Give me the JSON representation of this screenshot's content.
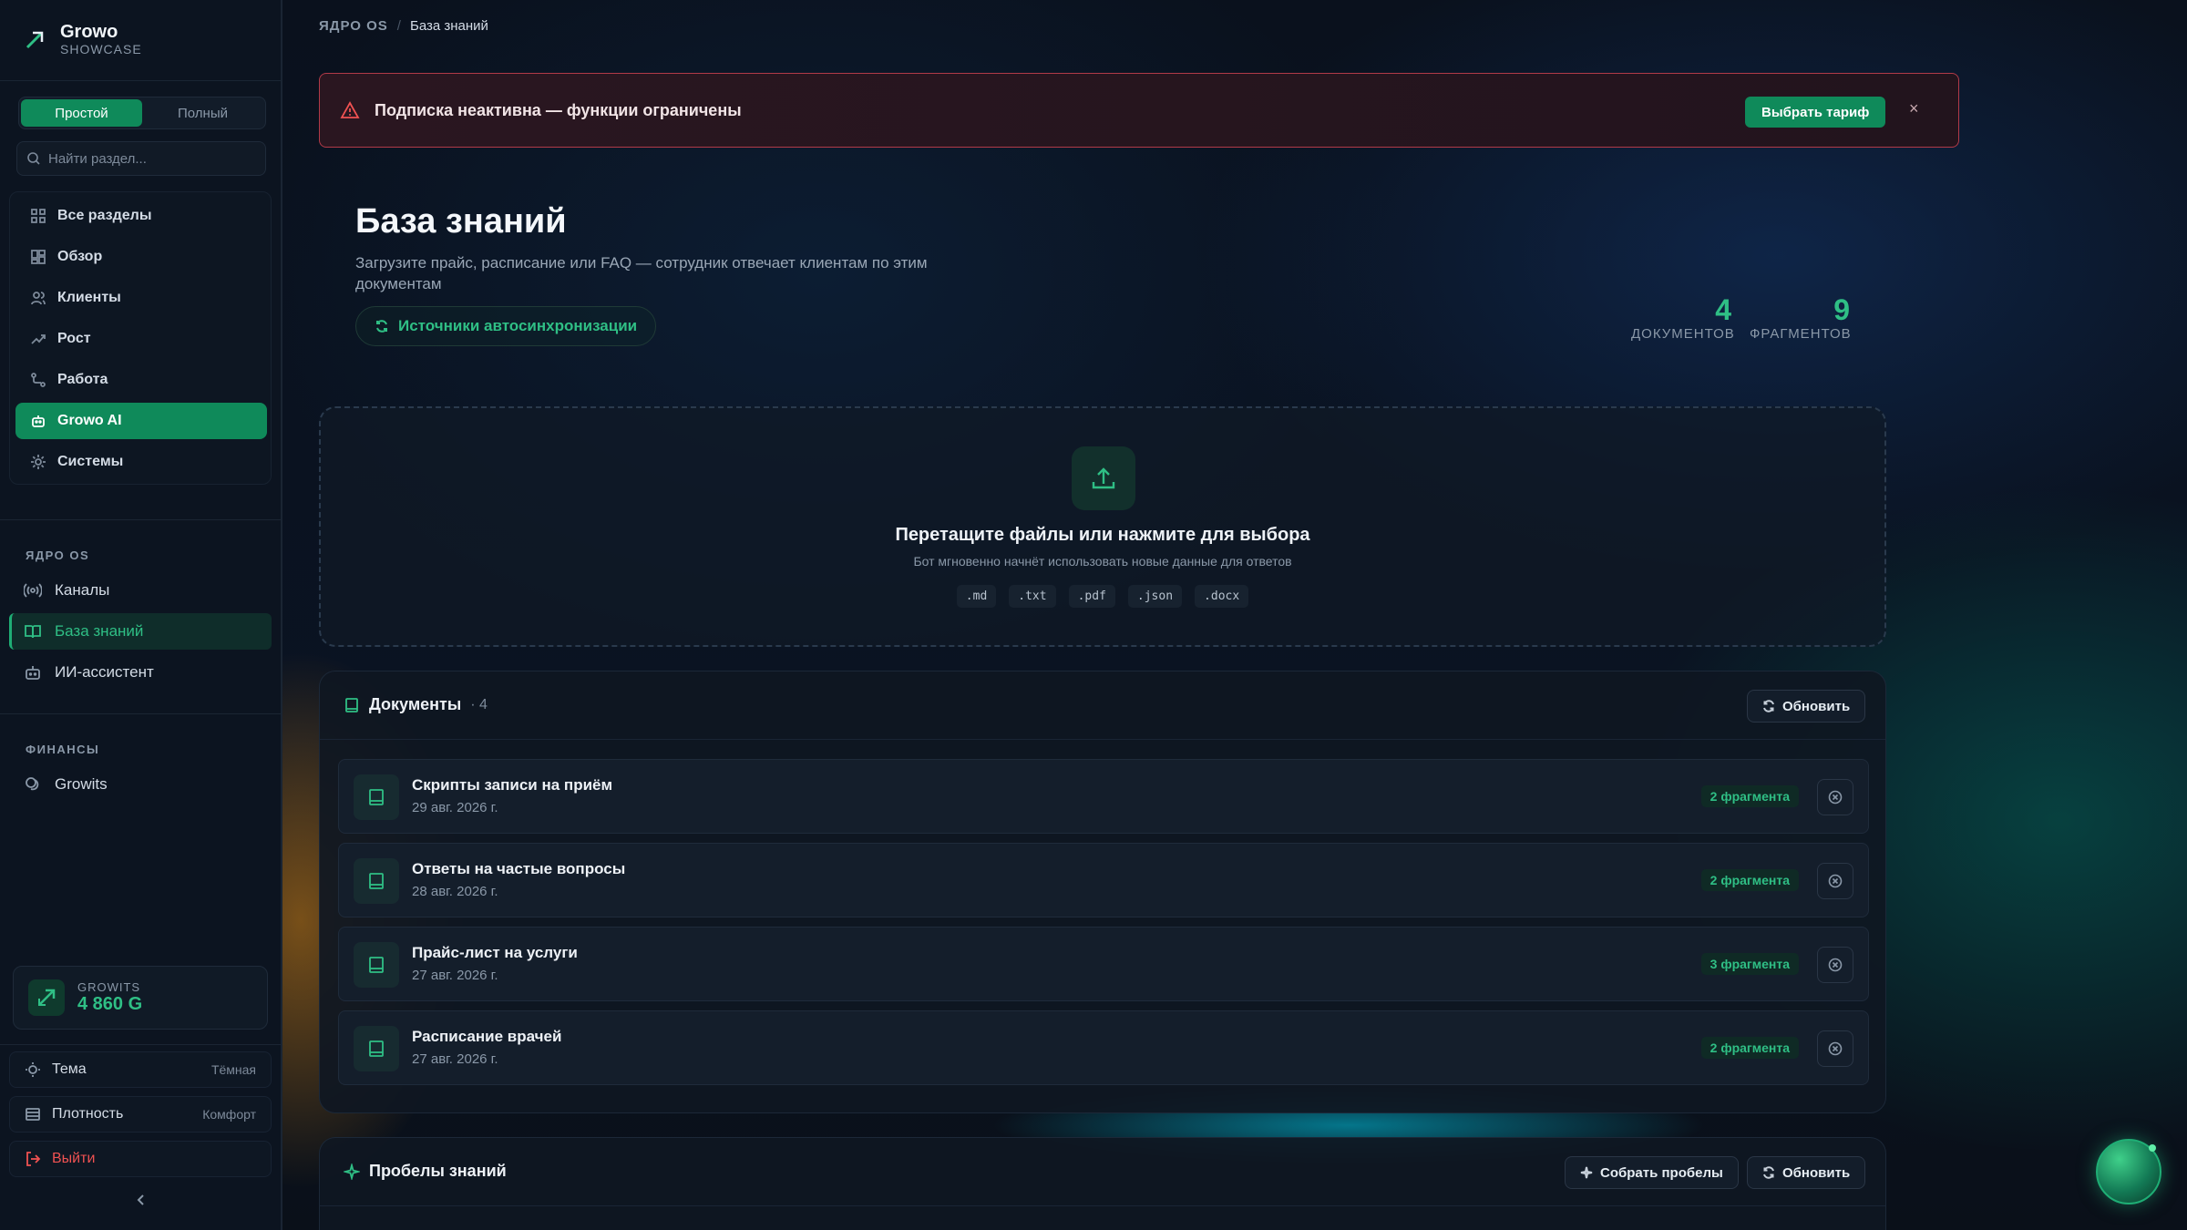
{
  "brand": {
    "name": "Growo",
    "sub": "SHOWCASE"
  },
  "mode": {
    "simple": "Простой",
    "full": "Полный"
  },
  "search": {
    "placeholder": "Найти раздел..."
  },
  "nav": [
    {
      "label": "Все разделы",
      "icon": "grid-icon"
    },
    {
      "label": "Обзор",
      "icon": "dashboard-icon"
    },
    {
      "label": "Клиенты",
      "icon": "users-icon"
    },
    {
      "label": "Рост",
      "icon": "trend-icon"
    },
    {
      "label": "Работа",
      "icon": "workflow-icon"
    },
    {
      "label": "Growo AI",
      "icon": "bot-icon",
      "active": true
    },
    {
      "label": "Системы",
      "icon": "gear-icon"
    }
  ],
  "sections": {
    "core": {
      "title": "ЯДРО OS",
      "items": [
        "Каналы",
        "База знаний",
        "ИИ-ассистент"
      ]
    },
    "finance": {
      "title": "ФИНАНСЫ",
      "items": [
        "Growits"
      ]
    }
  },
  "wallet": {
    "label": "GROWITS",
    "value": "4 860 G"
  },
  "settings": {
    "theme": {
      "label": "Тема",
      "value": "Тёмная"
    },
    "density": {
      "label": "Плотность",
      "value": "Комфорт"
    },
    "logout": "Выйти"
  },
  "breadcrumb": {
    "root": "ЯДРО OS",
    "sep": "/",
    "current": "База знаний"
  },
  "alert": {
    "text": "Подписка неактивна — функции ограничены",
    "button": "Выбрать тариф",
    "close": "×"
  },
  "page": {
    "title": "База знаний",
    "subtitle": "Загрузите прайс, расписание или FAQ — сотрудник отвечает клиентам по этим документам",
    "sync_button": "Источники автосинхронизации"
  },
  "stats": [
    {
      "value": "4",
      "label": "ДОКУМЕНТОВ"
    },
    {
      "value": "9",
      "label": "ФРАГМЕНТОВ"
    }
  ],
  "dropzone": {
    "title": "Перетащите файлы или нажмите для выбора",
    "subtitle": "Бот мгновенно начнёт использовать новые данные для ответов",
    "formats": [
      ".md",
      ".txt",
      ".pdf",
      ".json",
      ".docx"
    ]
  },
  "documents": {
    "title": "Документы",
    "count": "· 4",
    "refresh": "Обновить",
    "items": [
      {
        "name": "Скрипты записи на приём",
        "date": "29 авг. 2026 г.",
        "chunks": "2 фрагмента"
      },
      {
        "name": "Ответы на частые вопросы",
        "date": "28 авг. 2026 г.",
        "chunks": "2 фрагмента"
      },
      {
        "name": "Прайс-лист на услуги",
        "date": "27 авг. 2026 г.",
        "chunks": "3 фрагмента"
      },
      {
        "name": "Расписание врачей",
        "date": "27 авг. 2026 г.",
        "chunks": "2 фрагмента"
      }
    ]
  },
  "gaps": {
    "title": "Пробелы знаний",
    "collect": "Собрать пробелы",
    "refresh": "Обновить"
  },
  "colors": {
    "accent": "#0f8a5a",
    "accent_text": "#2fbf85",
    "danger": "#f05252"
  }
}
